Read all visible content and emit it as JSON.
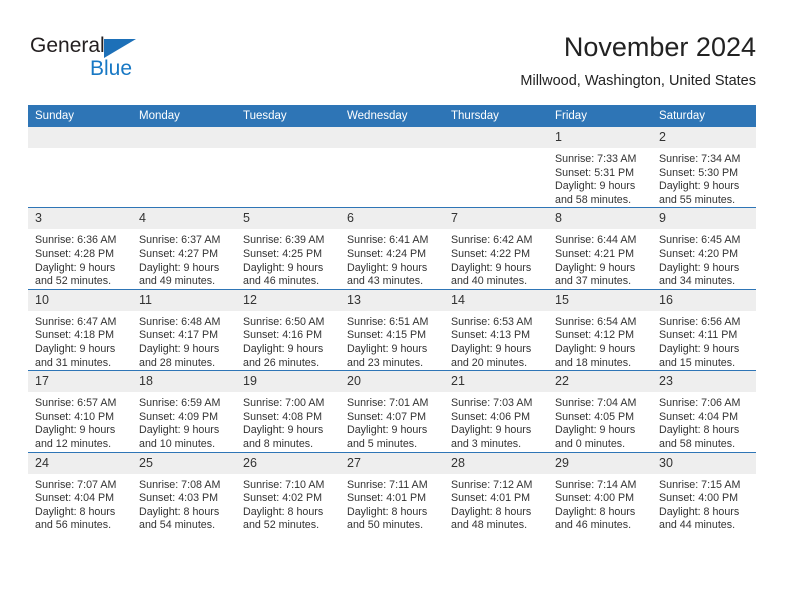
{
  "brand": {
    "name_top": "General",
    "name_bottom": "Blue",
    "triangle_color": "#1d70b8",
    "blue_color": "#1878c4"
  },
  "header": {
    "title": "November 2024",
    "subtitle": "Millwood, Washington, United States"
  },
  "theme": {
    "header_bg": "#2e75b6",
    "daynum_bg": "#eeeeee",
    "row_rule": "#2e75b6",
    "text": "#333333"
  },
  "weekdays": [
    "Sunday",
    "Monday",
    "Tuesday",
    "Wednesday",
    "Thursday",
    "Friday",
    "Saturday"
  ],
  "weeks": [
    [
      {
        "day": "",
        "empty": true
      },
      {
        "day": "",
        "empty": true
      },
      {
        "day": "",
        "empty": true
      },
      {
        "day": "",
        "empty": true
      },
      {
        "day": "",
        "empty": true
      },
      {
        "day": "1",
        "sunrise": "Sunrise: 7:33 AM",
        "sunset": "Sunset: 5:31 PM",
        "daylight1": "Daylight: 9 hours",
        "daylight2": "and 58 minutes."
      },
      {
        "day": "2",
        "sunrise": "Sunrise: 7:34 AM",
        "sunset": "Sunset: 5:30 PM",
        "daylight1": "Daylight: 9 hours",
        "daylight2": "and 55 minutes."
      }
    ],
    [
      {
        "day": "3",
        "sunrise": "Sunrise: 6:36 AM",
        "sunset": "Sunset: 4:28 PM",
        "daylight1": "Daylight: 9 hours",
        "daylight2": "and 52 minutes."
      },
      {
        "day": "4",
        "sunrise": "Sunrise: 6:37 AM",
        "sunset": "Sunset: 4:27 PM",
        "daylight1": "Daylight: 9 hours",
        "daylight2": "and 49 minutes."
      },
      {
        "day": "5",
        "sunrise": "Sunrise: 6:39 AM",
        "sunset": "Sunset: 4:25 PM",
        "daylight1": "Daylight: 9 hours",
        "daylight2": "and 46 minutes."
      },
      {
        "day": "6",
        "sunrise": "Sunrise: 6:41 AM",
        "sunset": "Sunset: 4:24 PM",
        "daylight1": "Daylight: 9 hours",
        "daylight2": "and 43 minutes."
      },
      {
        "day": "7",
        "sunrise": "Sunrise: 6:42 AM",
        "sunset": "Sunset: 4:22 PM",
        "daylight1": "Daylight: 9 hours",
        "daylight2": "and 40 minutes."
      },
      {
        "day": "8",
        "sunrise": "Sunrise: 6:44 AM",
        "sunset": "Sunset: 4:21 PM",
        "daylight1": "Daylight: 9 hours",
        "daylight2": "and 37 minutes."
      },
      {
        "day": "9",
        "sunrise": "Sunrise: 6:45 AM",
        "sunset": "Sunset: 4:20 PM",
        "daylight1": "Daylight: 9 hours",
        "daylight2": "and 34 minutes."
      }
    ],
    [
      {
        "day": "10",
        "sunrise": "Sunrise: 6:47 AM",
        "sunset": "Sunset: 4:18 PM",
        "daylight1": "Daylight: 9 hours",
        "daylight2": "and 31 minutes."
      },
      {
        "day": "11",
        "sunrise": "Sunrise: 6:48 AM",
        "sunset": "Sunset: 4:17 PM",
        "daylight1": "Daylight: 9 hours",
        "daylight2": "and 28 minutes."
      },
      {
        "day": "12",
        "sunrise": "Sunrise: 6:50 AM",
        "sunset": "Sunset: 4:16 PM",
        "daylight1": "Daylight: 9 hours",
        "daylight2": "and 26 minutes."
      },
      {
        "day": "13",
        "sunrise": "Sunrise: 6:51 AM",
        "sunset": "Sunset: 4:15 PM",
        "daylight1": "Daylight: 9 hours",
        "daylight2": "and 23 minutes."
      },
      {
        "day": "14",
        "sunrise": "Sunrise: 6:53 AM",
        "sunset": "Sunset: 4:13 PM",
        "daylight1": "Daylight: 9 hours",
        "daylight2": "and 20 minutes."
      },
      {
        "day": "15",
        "sunrise": "Sunrise: 6:54 AM",
        "sunset": "Sunset: 4:12 PM",
        "daylight1": "Daylight: 9 hours",
        "daylight2": "and 18 minutes."
      },
      {
        "day": "16",
        "sunrise": "Sunrise: 6:56 AM",
        "sunset": "Sunset: 4:11 PM",
        "daylight1": "Daylight: 9 hours",
        "daylight2": "and 15 minutes."
      }
    ],
    [
      {
        "day": "17",
        "sunrise": "Sunrise: 6:57 AM",
        "sunset": "Sunset: 4:10 PM",
        "daylight1": "Daylight: 9 hours",
        "daylight2": "and 12 minutes."
      },
      {
        "day": "18",
        "sunrise": "Sunrise: 6:59 AM",
        "sunset": "Sunset: 4:09 PM",
        "daylight1": "Daylight: 9 hours",
        "daylight2": "and 10 minutes."
      },
      {
        "day": "19",
        "sunrise": "Sunrise: 7:00 AM",
        "sunset": "Sunset: 4:08 PM",
        "daylight1": "Daylight: 9 hours",
        "daylight2": "and 8 minutes."
      },
      {
        "day": "20",
        "sunrise": "Sunrise: 7:01 AM",
        "sunset": "Sunset: 4:07 PM",
        "daylight1": "Daylight: 9 hours",
        "daylight2": "and 5 minutes."
      },
      {
        "day": "21",
        "sunrise": "Sunrise: 7:03 AM",
        "sunset": "Sunset: 4:06 PM",
        "daylight1": "Daylight: 9 hours",
        "daylight2": "and 3 minutes."
      },
      {
        "day": "22",
        "sunrise": "Sunrise: 7:04 AM",
        "sunset": "Sunset: 4:05 PM",
        "daylight1": "Daylight: 9 hours",
        "daylight2": "and 0 minutes."
      },
      {
        "day": "23",
        "sunrise": "Sunrise: 7:06 AM",
        "sunset": "Sunset: 4:04 PM",
        "daylight1": "Daylight: 8 hours",
        "daylight2": "and 58 minutes."
      }
    ],
    [
      {
        "day": "24",
        "sunrise": "Sunrise: 7:07 AM",
        "sunset": "Sunset: 4:04 PM",
        "daylight1": "Daylight: 8 hours",
        "daylight2": "and 56 minutes."
      },
      {
        "day": "25",
        "sunrise": "Sunrise: 7:08 AM",
        "sunset": "Sunset: 4:03 PM",
        "daylight1": "Daylight: 8 hours",
        "daylight2": "and 54 minutes."
      },
      {
        "day": "26",
        "sunrise": "Sunrise: 7:10 AM",
        "sunset": "Sunset: 4:02 PM",
        "daylight1": "Daylight: 8 hours",
        "daylight2": "and 52 minutes."
      },
      {
        "day": "27",
        "sunrise": "Sunrise: 7:11 AM",
        "sunset": "Sunset: 4:01 PM",
        "daylight1": "Daylight: 8 hours",
        "daylight2": "and 50 minutes."
      },
      {
        "day": "28",
        "sunrise": "Sunrise: 7:12 AM",
        "sunset": "Sunset: 4:01 PM",
        "daylight1": "Daylight: 8 hours",
        "daylight2": "and 48 minutes."
      },
      {
        "day": "29",
        "sunrise": "Sunrise: 7:14 AM",
        "sunset": "Sunset: 4:00 PM",
        "daylight1": "Daylight: 8 hours",
        "daylight2": "and 46 minutes."
      },
      {
        "day": "30",
        "sunrise": "Sunrise: 7:15 AM",
        "sunset": "Sunset: 4:00 PM",
        "daylight1": "Daylight: 8 hours",
        "daylight2": "and 44 minutes."
      }
    ]
  ]
}
